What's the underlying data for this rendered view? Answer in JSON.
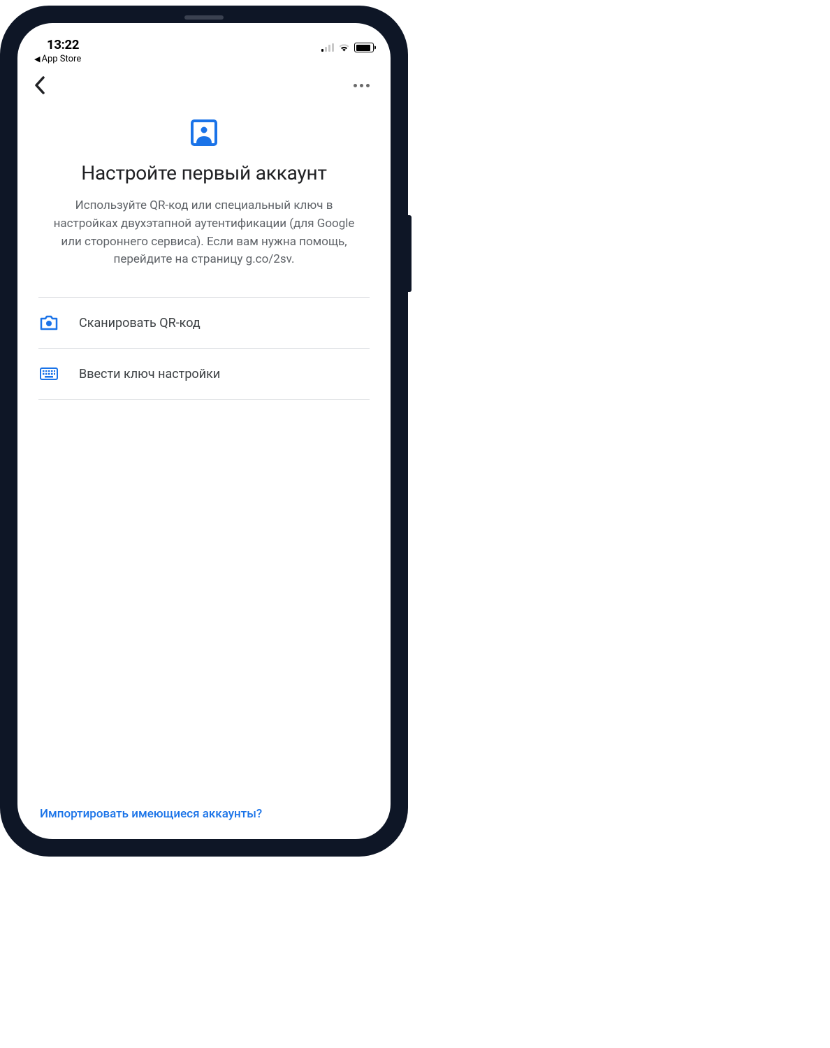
{
  "status": {
    "time": "13:22",
    "back_app_label": "App Store"
  },
  "hero": {
    "title": "Настройте первый аккаунт",
    "description": "Используйте QR-код или специальный ключ в настройках двухэтапной аутентификации (для Google или стороннего сервиса). Если вам нужна помощь, перейдите на страницу g.co/2sv."
  },
  "options": {
    "scan_qr": "Сканировать QR-код",
    "enter_key": "Ввести ключ настройки"
  },
  "footer": {
    "import_link": "Импортировать имеющиеся аккаунты?"
  },
  "colors": {
    "accent": "#1a73e8",
    "text_primary": "#202124",
    "text_secondary": "#5f6368"
  }
}
